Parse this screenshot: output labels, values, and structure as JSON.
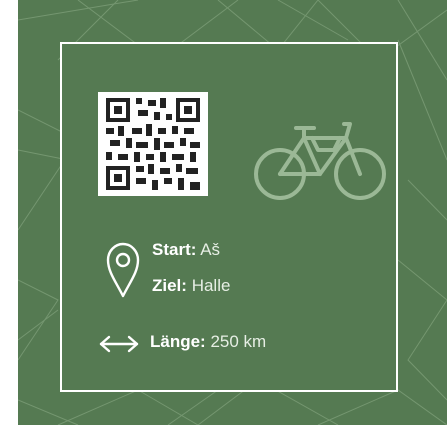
{
  "route": {
    "start_label": "Start:",
    "start_value": "Aš",
    "ziel_label": "Ziel:",
    "ziel_value": "Halle",
    "laenge_label": "Länge:",
    "laenge_value": "250 km"
  },
  "icons": {
    "qr": "qr-code-icon",
    "bike": "bicycle-icon",
    "pin": "map-pin-icon",
    "arrow": "double-arrow-icon"
  },
  "colors": {
    "background": "#557a52",
    "frame": "#ffffff",
    "bike_icon": "#9bb896",
    "pattern_lines": "#8fae89"
  }
}
